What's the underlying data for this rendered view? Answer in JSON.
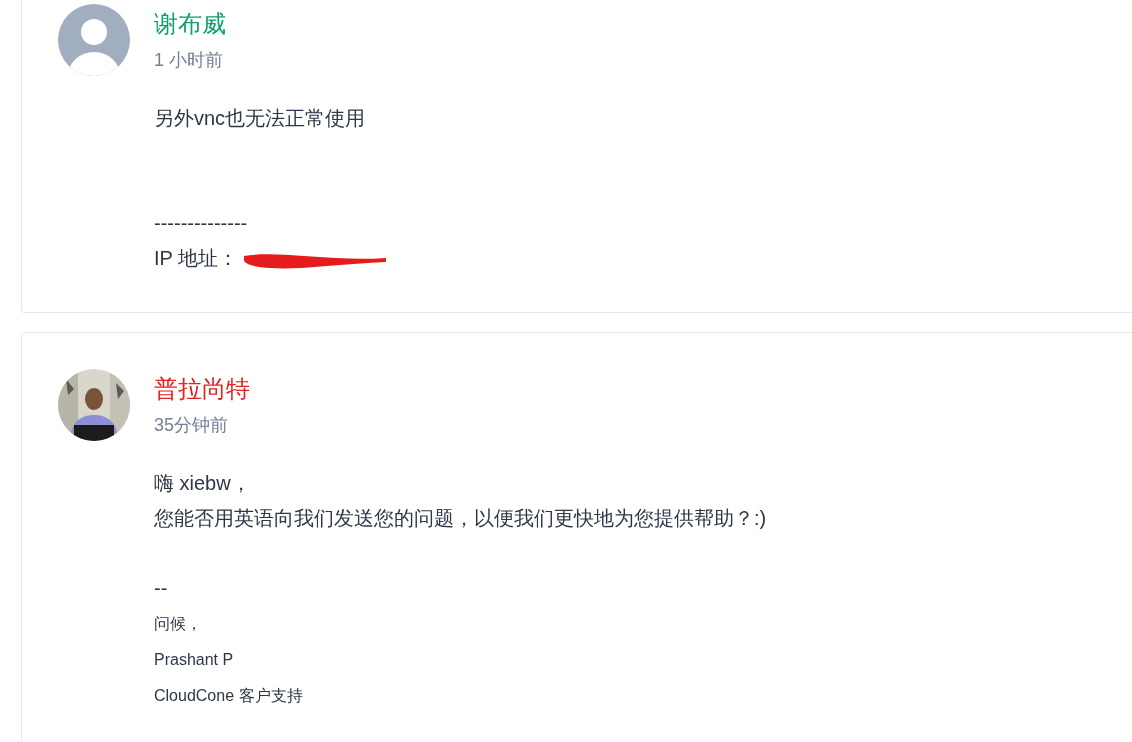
{
  "posts": [
    {
      "author": "谢布威",
      "color": "#0e9f6e",
      "time": "1 小时前",
      "avatar": {
        "kind": "default"
      },
      "body": [
        {
          "kind": "text",
          "text": "另外vnc也无法正常使用"
        },
        {
          "kind": "blank"
        },
        {
          "kind": "blank"
        },
        {
          "kind": "text",
          "text": "--------------"
        },
        {
          "kind": "redacted",
          "text": "IP 地址："
        }
      ]
    },
    {
      "author": "普拉尚特",
      "color": "#e02424",
      "time": "35分钟前",
      "body": [
        {
          "kind": "text",
          "text": "嗨 xiebw，"
        },
        {
          "kind": "text",
          "text": "您能否用英语向我们发送您的问题，以便我们更快地为您提供帮助？:)"
        },
        {
          "kind": "blank"
        },
        {
          "kind": "text",
          "text": "--"
        },
        {
          "kind": "small",
          "text": "问候，"
        },
        {
          "kind": "small",
          "text": "Prashant P"
        },
        {
          "kind": "small",
          "text": "CloudCone 客户支持"
        }
      ]
    }
  ]
}
